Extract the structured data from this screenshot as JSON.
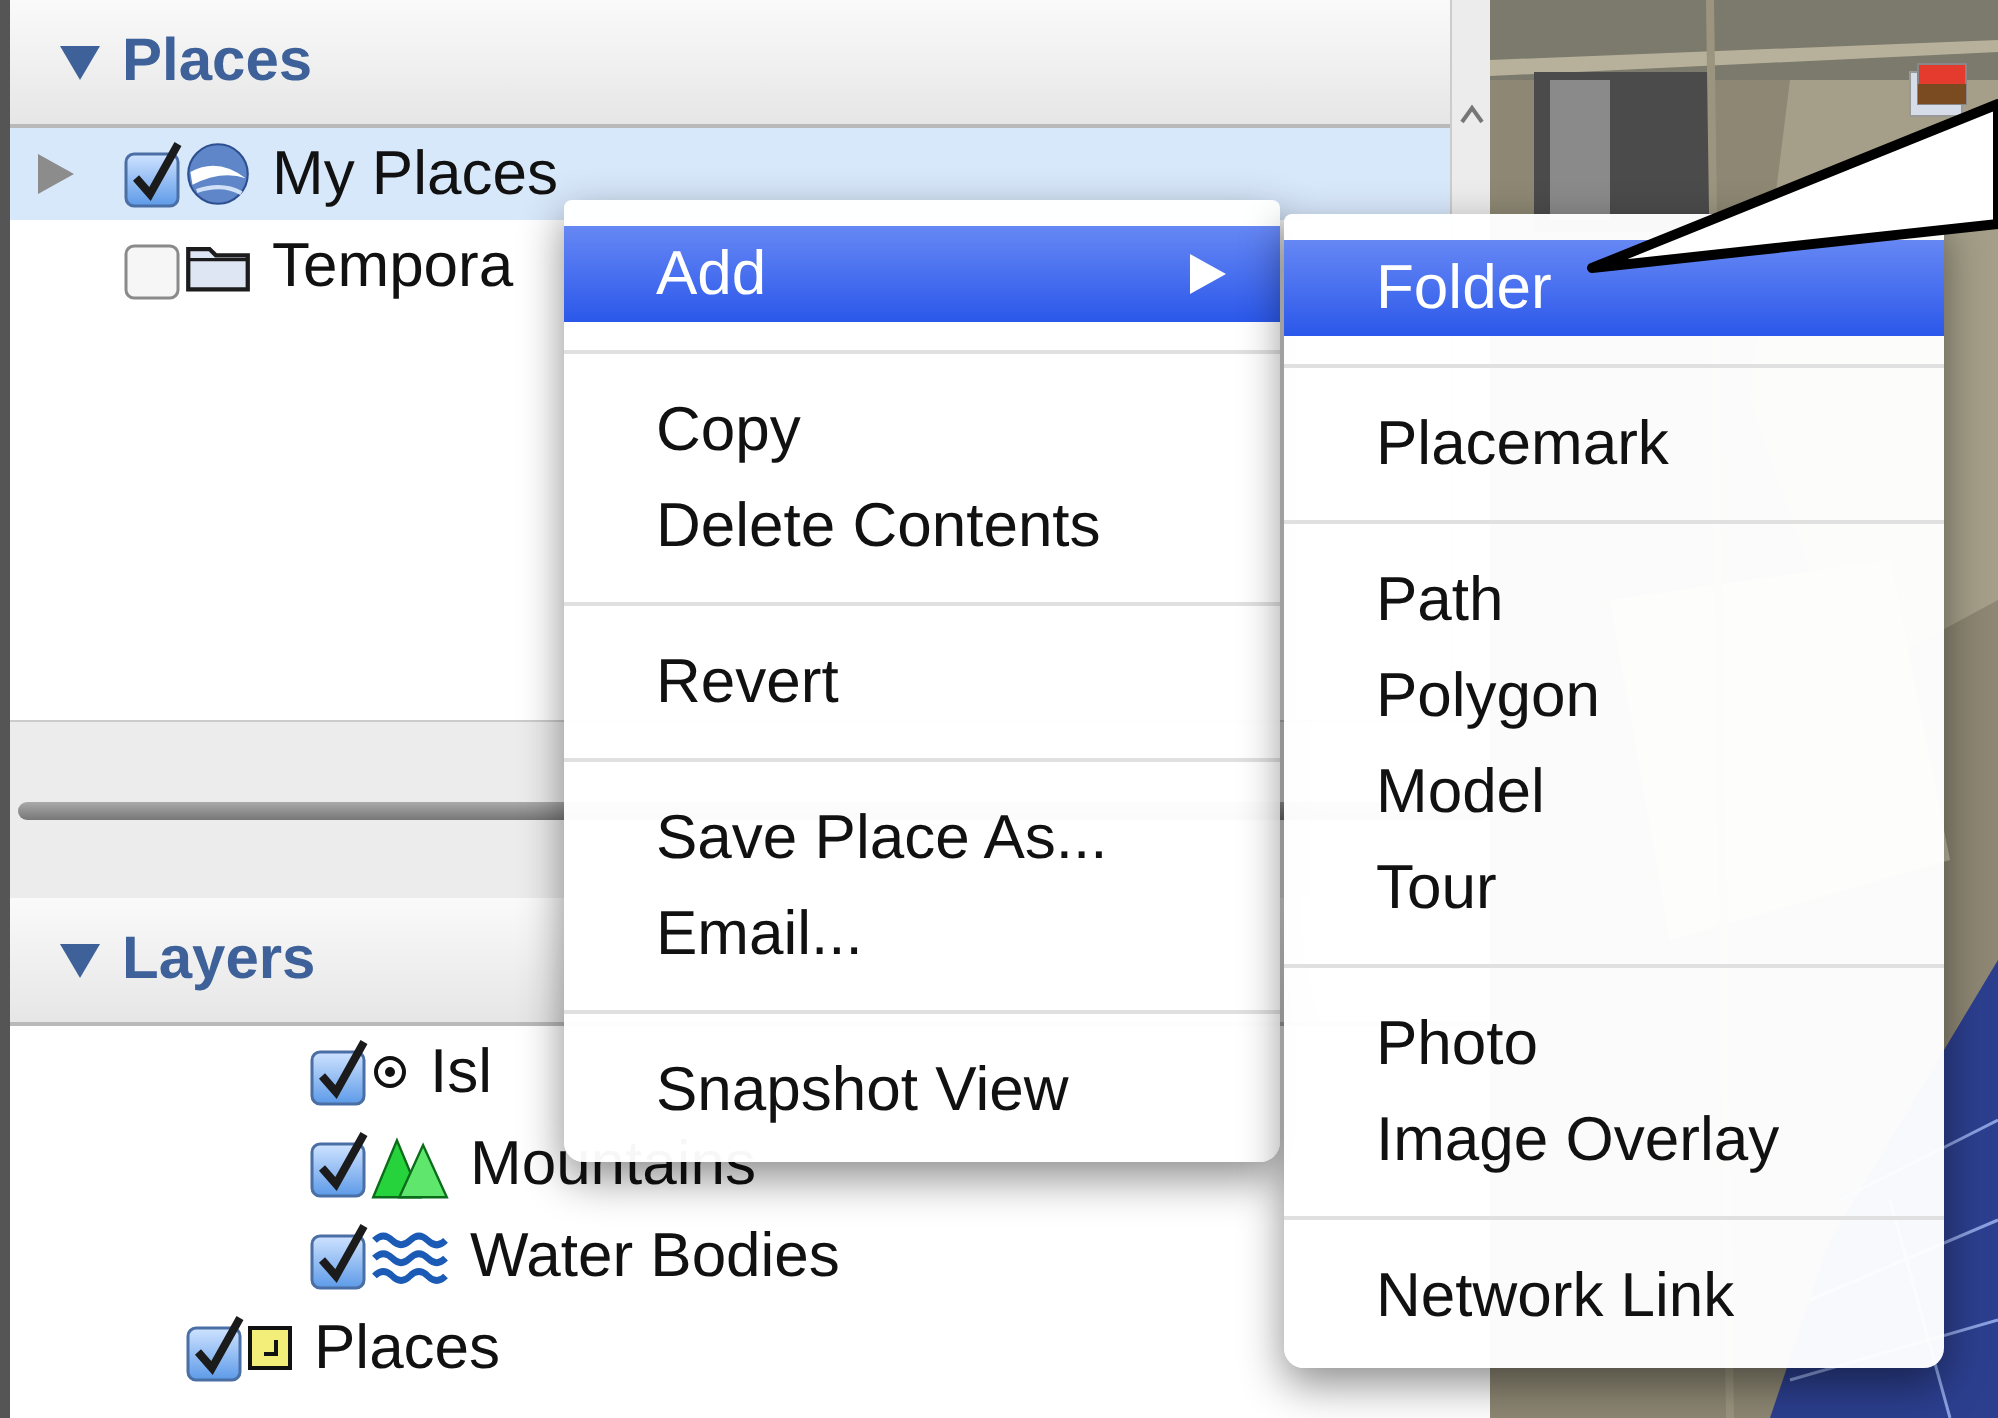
{
  "places_panel": {
    "title": "Places",
    "expanded": true,
    "items": [
      {
        "label": "My Places",
        "checked": true,
        "selected": true,
        "expanded": false
      },
      {
        "label": "Tempora",
        "checked": false,
        "selected": false
      }
    ]
  },
  "layers_panel": {
    "title": "Layers",
    "expanded": true,
    "items": [
      {
        "children": [
          {
            "label": "Isl",
            "checked": true,
            "selected": false
          },
          {
            "label": "Mountains",
            "checked": true,
            "selected": false
          },
          {
            "label": "Water Bodies",
            "checked": true,
            "selected": false
          }
        ]
      },
      {
        "label": "Places",
        "checked": true,
        "selected": false
      }
    ]
  },
  "context_menu": {
    "items": [
      {
        "kind": "item",
        "label": "Add",
        "selected": true,
        "has_submenu": true
      },
      {
        "kind": "separator"
      },
      {
        "kind": "item",
        "label": "Copy",
        "selected": false,
        "has_submenu": false
      },
      {
        "kind": "item",
        "label": "Delete Contents",
        "selected": false,
        "has_submenu": false
      },
      {
        "kind": "separator"
      },
      {
        "kind": "item",
        "label": "Revert",
        "selected": false,
        "has_submenu": false
      },
      {
        "kind": "separator"
      },
      {
        "kind": "item",
        "label": "Save Place As...",
        "selected": false,
        "has_submenu": false
      },
      {
        "kind": "item",
        "label": "Email...",
        "selected": false,
        "has_submenu": false
      },
      {
        "kind": "separator"
      },
      {
        "kind": "item",
        "label": "Snapshot View",
        "selected": false,
        "has_submenu": false
      }
    ]
  },
  "submenu": {
    "items": [
      {
        "kind": "item",
        "label": "Folder",
        "selected": true
      },
      {
        "kind": "separator"
      },
      {
        "kind": "item",
        "label": "Placemark",
        "selected": false
      },
      {
        "kind": "separator"
      },
      {
        "kind": "item",
        "label": "Path",
        "selected": false
      },
      {
        "kind": "item",
        "label": "Polygon",
        "selected": false
      },
      {
        "kind": "item",
        "label": "Model",
        "selected": false
      },
      {
        "kind": "item",
        "label": "Tour",
        "selected": false
      },
      {
        "kind": "separator"
      },
      {
        "kind": "item",
        "label": "Photo",
        "selected": false
      },
      {
        "kind": "item",
        "label": "Image Overlay",
        "selected": false
      },
      {
        "kind": "separator"
      },
      {
        "kind": "item",
        "label": "Network Link",
        "selected": false
      }
    ]
  }
}
